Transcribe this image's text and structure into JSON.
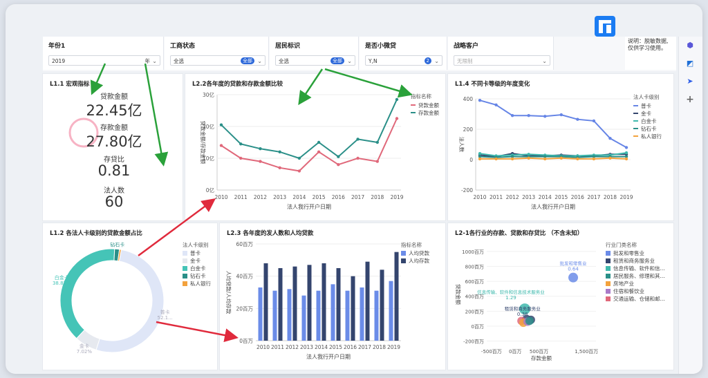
{
  "filters": [
    {
      "label": "年份1",
      "value": "2019",
      "suffix": "年"
    },
    {
      "label": "工商状态",
      "value": "全选",
      "tag": "全部"
    },
    {
      "label": "居民标识",
      "value": "全选",
      "tag": "全部"
    },
    {
      "label": "是否小微贷",
      "value": "Y,N",
      "tag": "2"
    },
    {
      "label": "战略客户",
      "placeholder": "无限制"
    }
  ],
  "note": {
    "line1": "说明：脱敏数据,",
    "line2": "仅供学习使用。"
  },
  "kpi": {
    "title": "L1.1 宏观指标",
    "items": [
      {
        "label": "贷款金额",
        "value": "22.45亿"
      },
      {
        "label": "存款金额",
        "value": "27.80亿"
      },
      {
        "label": "存贷比",
        "value": "0.81"
      },
      {
        "label": "法人数",
        "value": "60"
      }
    ]
  },
  "colors": {
    "accent": "#2b67d9",
    "teal": "#2a8f88",
    "pink": "#e0687a",
    "blue": "#6685e6",
    "navy": "#34456e",
    "arrow_green": "#2aa13a",
    "arrow_red": "#e02a3c"
  },
  "chart_data": [
    {
      "type": "line",
      "title": "L2.2各年度的贷款和存款金额比较",
      "xlabel": "法人我行开户日期",
      "ylabel": "贷款金额/存款金额",
      "legend_title": "指标名称",
      "x": [
        "2010",
        "2011",
        "2012",
        "2013",
        "2014",
        "2015",
        "2016",
        "2017",
        "2018",
        "2019"
      ],
      "y_ticks": [
        "0亿",
        "10亿",
        "20亿",
        "30亿"
      ],
      "ylim": [
        0,
        30
      ],
      "series": [
        {
          "name": "贷款金额",
          "color": "#e0687a",
          "values": [
            14,
            10,
            9,
            7,
            6,
            12,
            8,
            10,
            9,
            22.5
          ]
        },
        {
          "name": "存款金额",
          "color": "#2a8f88",
          "values": [
            20.5,
            14.5,
            13,
            12,
            10,
            15,
            10.5,
            16,
            15,
            28.5
          ]
        }
      ]
    },
    {
      "type": "line",
      "title": "L1.4 不同卡等级的年度变化",
      "xlabel": "法人我行开户日期",
      "ylabel": "法人数",
      "legend_title": "法人卡级别",
      "x": [
        "2010",
        "2011",
        "2012",
        "2013",
        "2014",
        "2015",
        "2016",
        "2017",
        "2018",
        "2019"
      ],
      "y_ticks": [
        "-200",
        "0",
        "200",
        "400"
      ],
      "ylim": [
        -200,
        400
      ],
      "series": [
        {
          "name": "普卡",
          "color": "#6685e6",
          "values": [
            390,
            360,
            290,
            290,
            285,
            295,
            265,
            255,
            140,
            80
          ]
        },
        {
          "name": "金卡",
          "color": "#34456e",
          "values": [
            30,
            20,
            40,
            25,
            25,
            30,
            25,
            25,
            35,
            35
          ]
        },
        {
          "name": "白金卡",
          "color": "#3fb9ad",
          "values": [
            40,
            25,
            30,
            35,
            30,
            25,
            25,
            30,
            30,
            45
          ]
        },
        {
          "name": "钻石卡",
          "color": "#2a8f88",
          "values": [
            20,
            15,
            20,
            20,
            20,
            20,
            15,
            20,
            20,
            20
          ]
        },
        {
          "name": "私人银行",
          "color": "#f3a23d",
          "values": [
            5,
            5,
            5,
            10,
            5,
            10,
            5,
            5,
            10,
            5
          ]
        }
      ]
    },
    {
      "type": "pie",
      "title": "L1.2 各法人卡级别的贷款金额占比",
      "legend_title": "法人卡级别",
      "slices": [
        {
          "name": "普卡",
          "color": "#dfe6f7",
          "value": 52.1,
          "label": "普卡",
          "pct": "52.1..."
        },
        {
          "name": "金卡",
          "color": "#e6e9ef",
          "value": 7.02,
          "label": "金卡",
          "pct": "7.02%"
        },
        {
          "name": "白金卡",
          "color": "#45c4b7",
          "value": 38.82,
          "label": "白金卡",
          "pct": "38.82%"
        },
        {
          "name": "钻石卡",
          "color": "#2a8f88",
          "value": 1.5,
          "label": "钻石卡",
          "pct": ""
        },
        {
          "name": "私人银行",
          "color": "#f3a23d",
          "value": 0.56,
          "label": "",
          "pct": ""
        }
      ]
    },
    {
      "type": "bar",
      "title": "L2.3 各年度的发人数和人均贷款",
      "xlabel": "法人我行开户日期",
      "ylabel": "人均贷款/人均存款",
      "legend_title": "指标名称",
      "categories": [
        "2010",
        "2011",
        "2012",
        "2013",
        "2014",
        "2015",
        "2016",
        "2017",
        "2018",
        "2019"
      ],
      "y_ticks": [
        "0百万",
        "20百万",
        "40百万",
        "60百万"
      ],
      "ylim": [
        0,
        60
      ],
      "series": [
        {
          "name": "人均贷款",
          "color": "#6b8ce8",
          "values": [
            33,
            31,
            32,
            28,
            31,
            35,
            31,
            33,
            31,
            37
          ]
        },
        {
          "name": "人均存款",
          "color": "#34456e",
          "values": [
            48,
            45,
            46,
            47,
            48,
            45,
            40,
            49,
            44,
            55
          ]
        }
      ]
    },
    {
      "type": "scatter",
      "title": "L2-1各行业的存款、贷款和存贷比 （不含未知）",
      "xlabel": "存款金额",
      "ylabel": "贷款金额",
      "legend_title": "行业门类名称",
      "x_ticks": [
        "-500百万",
        "0百万",
        "500百万",
        "1,500百万"
      ],
      "y_ticks": [
        "-200百万",
        "0百万",
        "200百万",
        "400百万",
        "600百万",
        "800百万",
        "1000百万"
      ],
      "xlim": [
        -600,
        1700
      ],
      "ylim": [
        -250,
        1100
      ],
      "legend": [
        {
          "name": "批发和零售业",
          "color": "#6b8ce8"
        },
        {
          "name": "租赁和商务服务业",
          "color": "#34456e"
        },
        {
          "name": "信息传输、软件和信...",
          "color": "#3fb9ad"
        },
        {
          "name": "居民服务、修理和其...",
          "color": "#2a8f88"
        },
        {
          "name": "房地产业",
          "color": "#f3a23d"
        },
        {
          "name": "住宿和餐饮业",
          "color": "#a97ac8"
        },
        {
          "name": "交通运输、仓储和邮...",
          "color": "#e0687a"
        }
      ],
      "points": [
        {
          "x": 1220,
          "y": 650,
          "r": 7,
          "color": "#6b8ce8",
          "name": "批发和零售业",
          "label": "0.64"
        },
        {
          "x": 200,
          "y": 230,
          "r": 8,
          "color": "#3fb9ad",
          "name": "信息传输、软件和信息技术服务业",
          "label": "1.29"
        },
        {
          "x": 240,
          "y": 85,
          "r": 7,
          "color": "#34456e",
          "name": "租赁和商务服务业",
          "label": "0.38"
        },
        {
          "x": 330,
          "y": 85,
          "r": 6,
          "color": "#34456e",
          "name": "",
          "label": ""
        },
        {
          "x": 130,
          "y": 70,
          "r": 6,
          "color": "#e0687a",
          "name": "",
          "label": ""
        },
        {
          "x": 170,
          "y": 45,
          "r": 6,
          "color": "#f3a23d",
          "name": "",
          "label": ""
        },
        {
          "x": 260,
          "y": 60,
          "r": 6,
          "color": "#a97ac8",
          "name": "",
          "label": ""
        },
        {
          "x": 300,
          "y": 70,
          "r": 6,
          "color": "#2a8f88",
          "name": "",
          "label": ""
        }
      ]
    }
  ]
}
